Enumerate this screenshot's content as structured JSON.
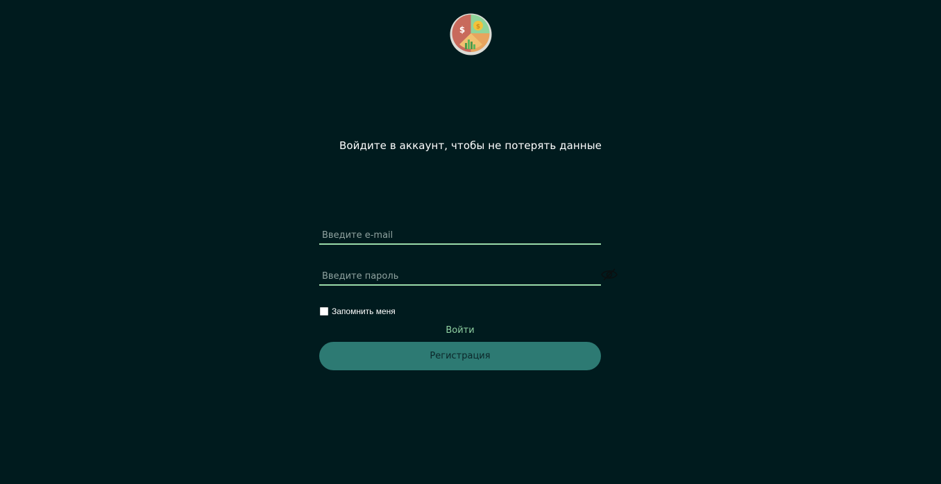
{
  "logo": {
    "icon": "finance-pie-chart-logo-icon"
  },
  "headline": "Войдите в аккаунт, чтобы не потерять данные",
  "form": {
    "email": {
      "placeholder": "Введите e-mail",
      "value": ""
    },
    "password": {
      "placeholder": "Введите пароль",
      "value": "",
      "toggle_icon": "eye-off-icon"
    },
    "remember": {
      "label": "Запомнить меня",
      "checked": false
    },
    "login_label": "Войти",
    "register_label": "Регистрация"
  },
  "colors": {
    "background": "#001b1e",
    "accent_line": "#9bdcab",
    "login_text": "#8fd0a2",
    "register_button": "#2d7a73"
  }
}
